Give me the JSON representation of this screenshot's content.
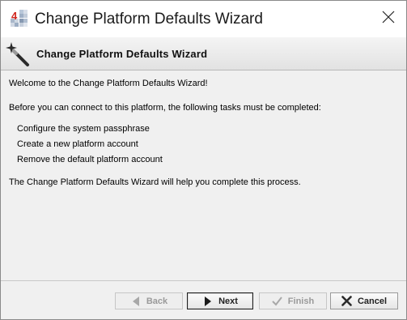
{
  "window": {
    "title": "Change Platform Defaults Wizard",
    "app_icon": "niagara-4-icon",
    "close_icon": "close-icon"
  },
  "header": {
    "title": "Change Platform Defaults Wizard",
    "icon": "magic-wand-icon"
  },
  "content": {
    "welcome": "Welcome to the Change Platform Defaults Wizard!",
    "intro": "Before you can connect to this platform, the following tasks must be completed:",
    "tasks": [
      "Configure the system passphrase",
      "Create a new platform account",
      "Remove the default platform account"
    ],
    "closing": "The Change Platform Defaults Wizard will help you complete this process."
  },
  "buttons": {
    "back": {
      "label": "Back",
      "icon": "triangle-left-icon",
      "enabled": false
    },
    "next": {
      "label": "Next",
      "icon": "triangle-right-icon",
      "enabled": true
    },
    "finish": {
      "label": "Finish",
      "icon": "checkmark-icon",
      "enabled": false
    },
    "cancel": {
      "label": "Cancel",
      "icon": "x-icon",
      "enabled": true
    }
  }
}
